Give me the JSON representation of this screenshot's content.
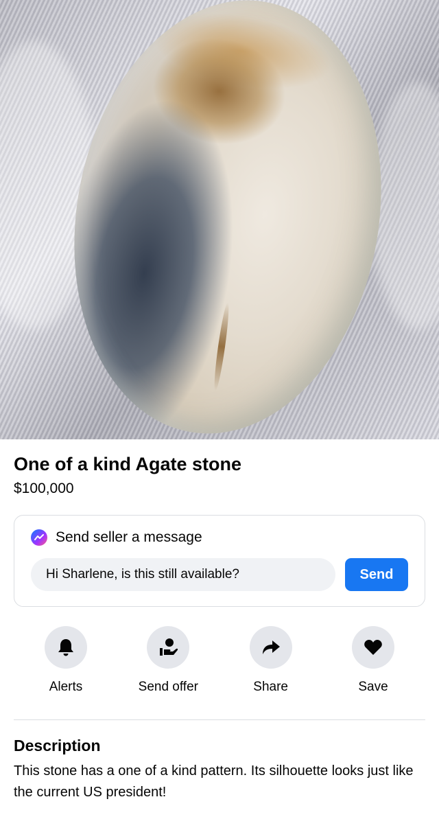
{
  "listing": {
    "title": "One of a kind Agate stone",
    "price": "$100,000"
  },
  "message": {
    "header": "Send seller a message",
    "input_value": "Hi Sharlene, is this still available?",
    "send_label": "Send",
    "icon": "messenger-icon"
  },
  "actions": [
    {
      "label": "Alerts",
      "icon": "bell-icon"
    },
    {
      "label": "Send offer",
      "icon": "offer-icon"
    },
    {
      "label": "Share",
      "icon": "share-arrow-icon"
    },
    {
      "label": "Save",
      "icon": "heart-icon"
    }
  ],
  "description": {
    "heading": "Description",
    "text": "This stone has a one of a kind pattern. Its silhouette looks just like the current US president!"
  },
  "colors": {
    "accent": "#1877f2",
    "chip_bg": "#e4e6eb",
    "input_bg": "#f0f2f5"
  }
}
